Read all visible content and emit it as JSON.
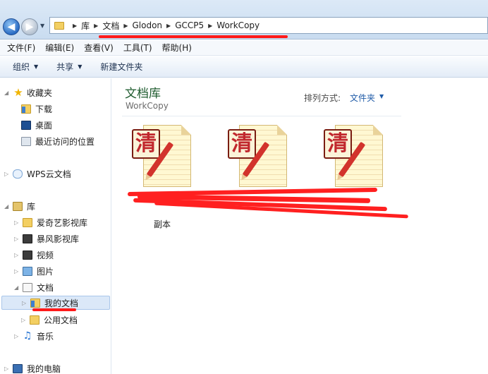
{
  "address_bar": {
    "breadcrumbs": [
      "库",
      "文档",
      "Glodon",
      "GCCP5",
      "WorkCopy"
    ]
  },
  "menu": {
    "items": [
      "文件(F)",
      "编辑(E)",
      "查看(V)",
      "工具(T)",
      "帮助(H)"
    ]
  },
  "toolbar": {
    "organize": "组织",
    "share": "共享",
    "new_folder": "新建文件夹"
  },
  "sidebar": {
    "favorites": "收藏夹",
    "downloads": "下载",
    "desktop": "桌面",
    "recent": "最近访问的位置",
    "wps_cloud": "WPS云文档",
    "libraries": "库",
    "iqiyi": "爱奇艺影视库",
    "baofeng": "暴风影视库",
    "videos": "视频",
    "pictures": "图片",
    "documents": "文档",
    "my_documents": "我的文档",
    "public_documents": "公用文档",
    "music": "音乐",
    "computer": "我的电脑"
  },
  "content": {
    "title": "文档库",
    "subtitle": "WorkCopy",
    "sort_label": "排列方式:",
    "sort_value": "文件夹",
    "files": [
      {
        "icon_char": "清",
        "label_line2": "副本"
      },
      {
        "icon_char": "清",
        "label_line2": ""
      },
      {
        "icon_char": "清",
        "label_line2": ""
      }
    ]
  },
  "colors": {
    "annotation": "#ff1a1a",
    "title_green": "#1e5b2e",
    "link_blue": "#1f5ba8"
  }
}
